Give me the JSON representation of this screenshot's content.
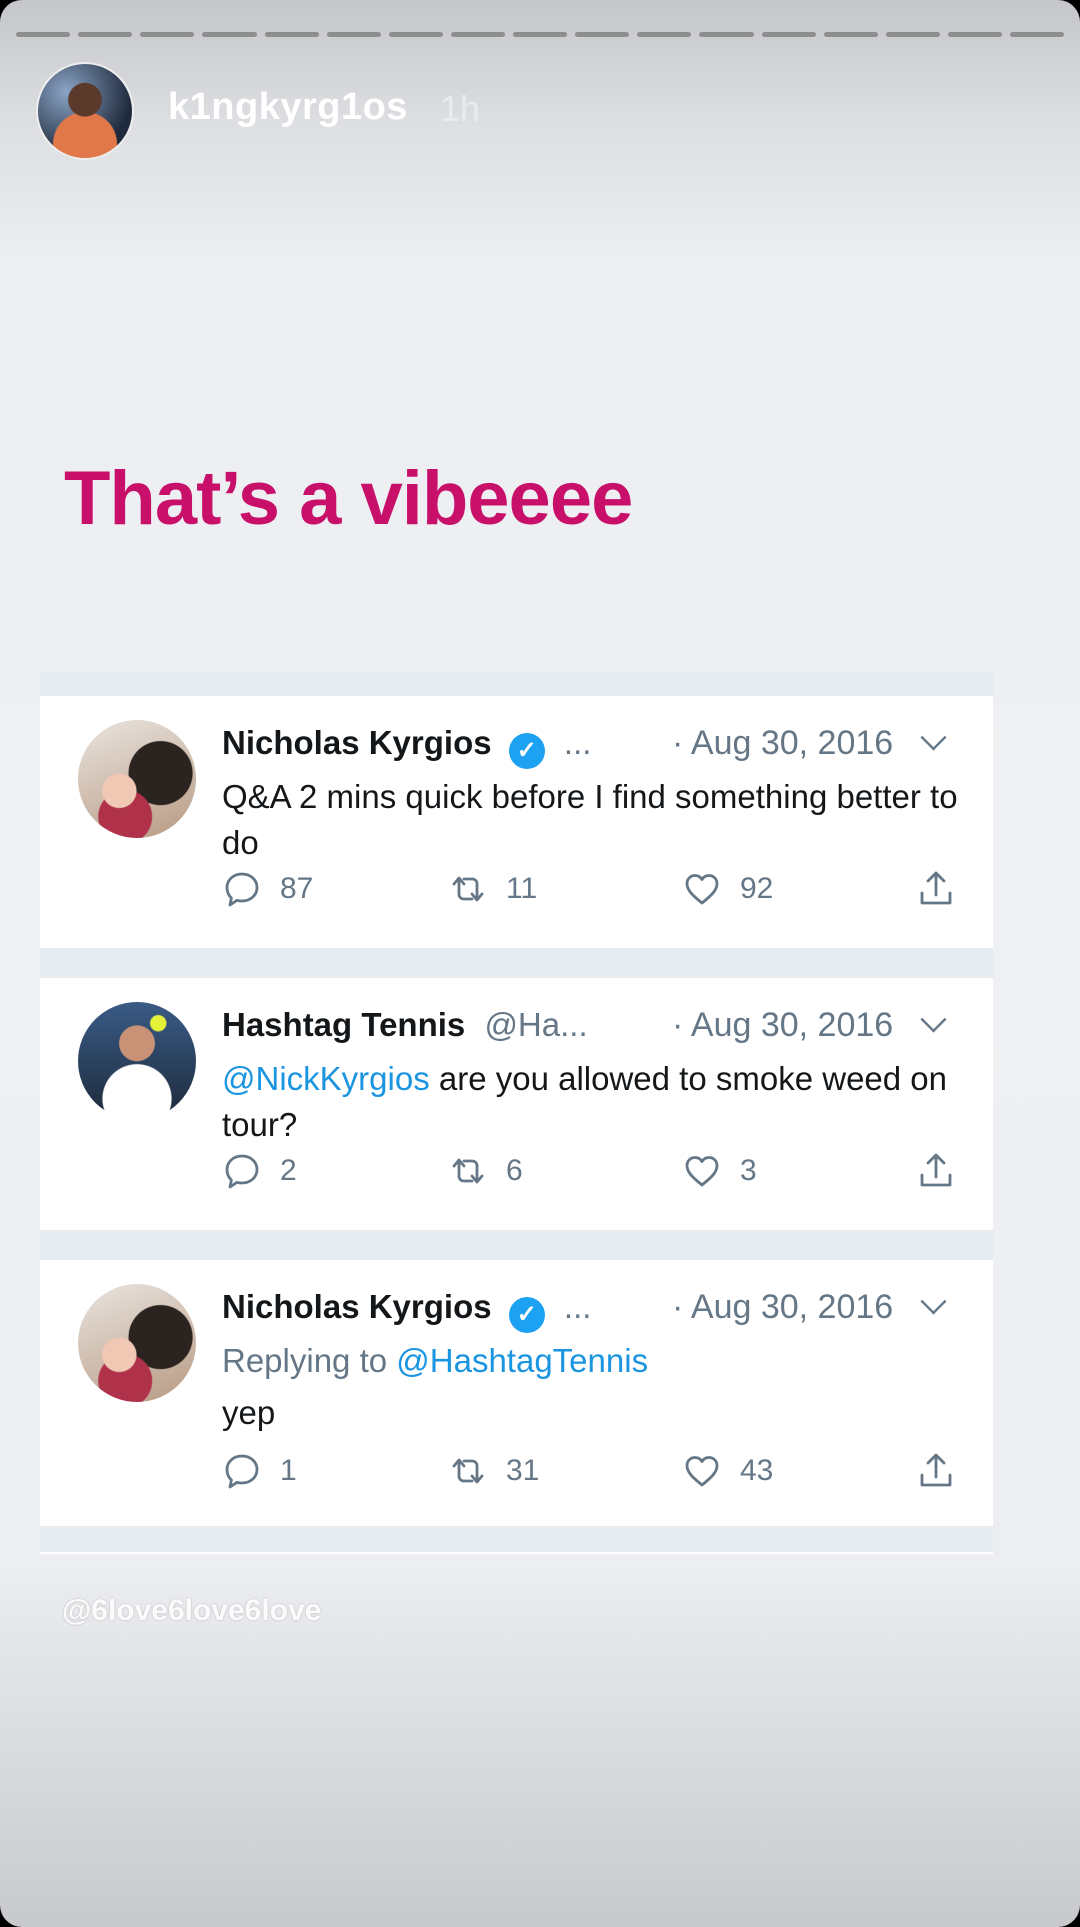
{
  "story": {
    "username": "k1ngkyrg1os",
    "time": "1h",
    "caption": "That’s a vibeeee",
    "watermark": "@6love6love6love",
    "segments": 17
  },
  "tweets": [
    {
      "name": "Nicholas Kyrgios",
      "verified": true,
      "handle": "...",
      "date": "· Aug 30, 2016",
      "mention": "",
      "text": "Q&A 2 mins quick before I find something better to do",
      "replying_prefix": "",
      "replying_to": "",
      "replies": "87",
      "retweets": "11",
      "likes": "92"
    },
    {
      "name": "Hashtag Tennis",
      "verified": false,
      "handle": "@Ha...",
      "date": "· Aug 30, 2016",
      "mention": "@NickKyrgios",
      "text": " are you allowed to smoke weed on tour?",
      "replying_prefix": "",
      "replying_to": "",
      "replies": "2",
      "retweets": "6",
      "likes": "3"
    },
    {
      "name": "Nicholas Kyrgios",
      "verified": true,
      "handle": "...",
      "date": "· Aug 30, 2016",
      "mention": "",
      "text": "yep",
      "replying_prefix": "Replying to ",
      "replying_to": "@HashtagTennis",
      "replies": "1",
      "retweets": "31",
      "likes": "43"
    }
  ],
  "colors": {
    "caption": "#c8106a",
    "link": "#1b95e0",
    "verified": "#1da1f2",
    "muted": "#657786"
  },
  "icons": [
    "reply-icon",
    "retweet-icon",
    "like-icon",
    "share-icon",
    "verified-badge-icon",
    "chevron-down-icon"
  ]
}
